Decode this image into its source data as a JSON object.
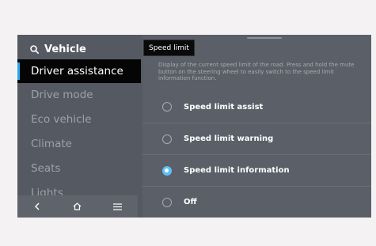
{
  "sidebar": {
    "search_label": "Vehicle",
    "items": [
      {
        "label": "Driver assistance",
        "active": true
      },
      {
        "label": "Drive mode",
        "active": false
      },
      {
        "label": "Eco vehicle",
        "active": false
      },
      {
        "label": "Climate",
        "active": false
      },
      {
        "label": "Seats",
        "active": false
      },
      {
        "label": "Lights",
        "active": false
      }
    ],
    "bottom_icons": [
      "back-icon",
      "home-icon",
      "menu-icon"
    ]
  },
  "tooltip": {
    "text": "Speed limit"
  },
  "panel": {
    "description": "Display of the current speed limit of the road. Press and hold the mute button on the steering wheel to easily switch to the speed limit information function.",
    "options": [
      {
        "label": "Speed limit assist",
        "selected": false
      },
      {
        "label": "Speed limit warning",
        "selected": false
      },
      {
        "label": "Speed limit information",
        "selected": true
      },
      {
        "label": "Off",
        "selected": false
      }
    ]
  },
  "colors": {
    "accent": "#5ec0f7",
    "active_bar": "#2ba8f0",
    "screen_bg": "#5b5f67",
    "page_bg": "#f4f2f2"
  }
}
